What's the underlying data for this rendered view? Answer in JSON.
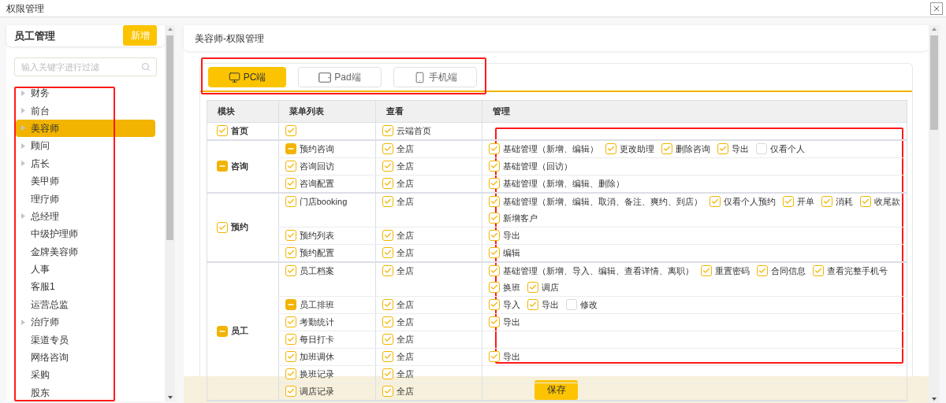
{
  "window": {
    "title": "权限管理"
  },
  "staff_panel": {
    "title": "员工管理",
    "add_button": "新增",
    "search": {
      "placeholder": "输入关键字进行过滤"
    },
    "roles": [
      {
        "label": "财务",
        "expandable": true,
        "selected": false
      },
      {
        "label": "前台",
        "expandable": true,
        "selected": false
      },
      {
        "label": "美容师",
        "expandable": true,
        "selected": true
      },
      {
        "label": "顾问",
        "expandable": true,
        "selected": false
      },
      {
        "label": "店长",
        "expandable": true,
        "selected": false
      },
      {
        "label": "美甲师",
        "expandable": false,
        "selected": false
      },
      {
        "label": "理疗师",
        "expandable": false,
        "selected": false
      },
      {
        "label": "总经理",
        "expandable": true,
        "selected": false
      },
      {
        "label": "中级护理师",
        "expandable": false,
        "selected": false
      },
      {
        "label": "金牌美容师",
        "expandable": false,
        "selected": false
      },
      {
        "label": "人事",
        "expandable": false,
        "selected": false
      },
      {
        "label": "客服1",
        "expandable": false,
        "selected": false
      },
      {
        "label": "运营总监",
        "expandable": false,
        "selected": false
      },
      {
        "label": "治疗师",
        "expandable": true,
        "selected": false
      },
      {
        "label": "渠道专员",
        "expandable": false,
        "selected": false
      },
      {
        "label": "网络咨询",
        "expandable": false,
        "selected": false
      },
      {
        "label": "采购",
        "expandable": false,
        "selected": false
      },
      {
        "label": "股东",
        "expandable": false,
        "selected": false
      }
    ]
  },
  "permission_panel": {
    "title": "美容师-权限管理",
    "tabs": [
      {
        "label": "PC端",
        "kind": "desktop",
        "selected": true
      },
      {
        "label": "Pad端",
        "kind": "tablet",
        "selected": false
      },
      {
        "label": "手机端",
        "kind": "phone",
        "selected": false
      }
    ],
    "columns": [
      "模块",
      "菜单列表",
      "查看",
      "管理"
    ],
    "modules": [
      {
        "label": "首页",
        "checked": true,
        "indeterminate": false,
        "items": [
          {
            "checked": true,
            "indeterminate": false,
            "view": {
              "label": "云端首页",
              "checked": true,
              "indeterminate": false
            }
          }
        ]
      },
      {
        "label": "咨询",
        "checked": true,
        "indeterminate": true,
        "items": [
          {
            "label": "预约咨询",
            "checked": true,
            "indeterminate": true,
            "view": {
              "label": "全店",
              "checked": true,
              "indeterminate": false
            },
            "manage": [
              [
                {
                  "label": "基础管理（新增、编辑）",
                  "checked": true,
                  "indeterminate": false
                },
                {
                  "label": "更改助理",
                  "checked": true,
                  "indeterminate": false
                },
                {
                  "label": "删除咨询",
                  "checked": true,
                  "indeterminate": false
                },
                {
                  "label": "导出",
                  "checked": true,
                  "indeterminate": false
                },
                {
                  "label": "仅看个人",
                  "checked": false,
                  "indeterminate": false
                }
              ]
            ]
          },
          {
            "label": "咨询回访",
            "checked": true,
            "indeterminate": false,
            "view": {
              "label": "全店",
              "checked": true,
              "indeterminate": false
            },
            "manage": [
              [
                {
                  "label": "基础管理（回访）",
                  "checked": true,
                  "indeterminate": false
                }
              ]
            ]
          },
          {
            "label": "咨询配置",
            "checked": true,
            "indeterminate": false,
            "view": {
              "label": "全店",
              "checked": true,
              "indeterminate": false
            },
            "manage": [
              [
                {
                  "label": "基础管理（新增、编辑、删除）",
                  "checked": true,
                  "indeterminate": false
                }
              ]
            ]
          }
        ]
      },
      {
        "label": "预约",
        "checked": true,
        "indeterminate": false,
        "items": [
          {
            "label": "门店booking",
            "checked": true,
            "indeterminate": false,
            "view": {
              "label": "全店",
              "checked": true,
              "indeterminate": false
            },
            "manage": [
              [
                {
                  "label": "基础管理（新增、编辑、取消、备注、爽约、到店）",
                  "checked": true,
                  "indeterminate": false
                },
                {
                  "label": "仅看个人预约",
                  "checked": true,
                  "indeterminate": false
                },
                {
                  "label": "开单",
                  "checked": true,
                  "indeterminate": false
                },
                {
                  "label": "消耗",
                  "checked": true,
                  "indeterminate": false
                },
                {
                  "label": "收尾款",
                  "checked": true,
                  "indeterminate": false
                }
              ],
              [
                {
                  "label": "新增客户",
                  "checked": true,
                  "indeterminate": false
                }
              ]
            ]
          },
          {
            "label": "预约列表",
            "checked": true,
            "indeterminate": false,
            "view": {
              "label": "全店",
              "checked": true,
              "indeterminate": false
            },
            "manage": [
              [
                {
                  "label": "导出",
                  "checked": true,
                  "indeterminate": false
                }
              ]
            ]
          },
          {
            "label": "预约配置",
            "checked": true,
            "indeterminate": false,
            "view": {
              "label": "全店",
              "checked": true,
              "indeterminate": false
            },
            "manage": [
              [
                {
                  "label": "编辑",
                  "checked": true,
                  "indeterminate": false
                }
              ]
            ]
          }
        ]
      },
      {
        "label": "员工",
        "checked": true,
        "indeterminate": true,
        "items": [
          {
            "label": "员工档案",
            "checked": true,
            "indeterminate": false,
            "view": {
              "label": "全店",
              "checked": true,
              "indeterminate": false
            },
            "manage": [
              [
                {
                  "label": "基础管理（新增、导入、编辑、查看详情、离职）",
                  "checked": true,
                  "indeterminate": false
                },
                {
                  "label": "重置密码",
                  "checked": true,
                  "indeterminate": false
                },
                {
                  "label": "合同信息",
                  "checked": true,
                  "indeterminate": false
                },
                {
                  "label": "查看完整手机号",
                  "checked": true,
                  "indeterminate": false
                }
              ],
              [
                {
                  "label": "换班",
                  "checked": true,
                  "indeterminate": false
                },
                {
                  "label": "调店",
                  "checked": true,
                  "indeterminate": false
                }
              ]
            ]
          },
          {
            "label": "员工排班",
            "checked": true,
            "indeterminate": true,
            "view": {
              "label": "全店",
              "checked": true,
              "indeterminate": false
            },
            "manage": [
              [
                {
                  "label": "导入",
                  "checked": true,
                  "indeterminate": false
                },
                {
                  "label": "导出",
                  "checked": true,
                  "indeterminate": false
                },
                {
                  "label": "修改",
                  "checked": false,
                  "indeterminate": false
                }
              ]
            ]
          },
          {
            "label": "考勤统计",
            "checked": true,
            "indeterminate": false,
            "view": {
              "label": "全店",
              "checked": true,
              "indeterminate": false
            },
            "manage": [
              [
                {
                  "label": "导出",
                  "checked": true,
                  "indeterminate": false
                }
              ]
            ]
          },
          {
            "label": "每日打卡",
            "checked": true,
            "indeterminate": false,
            "view": {
              "label": "全店",
              "checked": true,
              "indeterminate": false
            }
          },
          {
            "label": "加班调休",
            "checked": true,
            "indeterminate": false,
            "view": {
              "label": "全店",
              "checked": true,
              "indeterminate": false
            },
            "manage": [
              [
                {
                  "label": "导出",
                  "checked": true,
                  "indeterminate": false
                }
              ]
            ]
          },
          {
            "label": "换班记录",
            "checked": true,
            "indeterminate": false,
            "view": {
              "label": "全店",
              "checked": true,
              "indeterminate": false
            }
          },
          {
            "label": "调店记录",
            "checked": true,
            "indeterminate": false,
            "view": {
              "label": "全店",
              "checked": true,
              "indeterminate": false
            }
          }
        ]
      }
    ],
    "save_button": "保存"
  }
}
